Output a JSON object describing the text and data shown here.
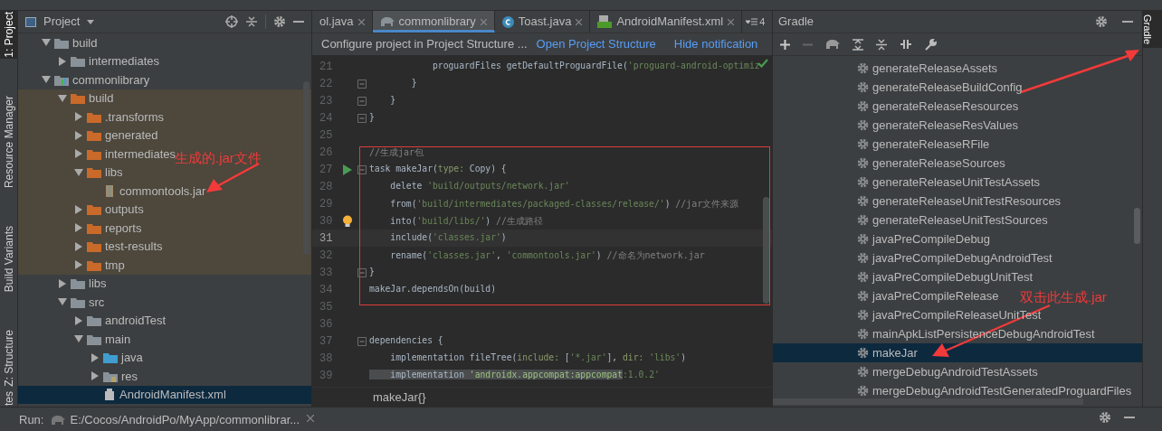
{
  "left_strip": [
    {
      "label": "1: Project",
      "selected": true
    },
    {
      "label": "Resource Manager",
      "selected": false
    },
    {
      "label": "Build Variants",
      "selected": false
    },
    {
      "label": "Z: Structure",
      "selected": false
    },
    {
      "label": "tes",
      "selected": false
    }
  ],
  "project_panel": {
    "title": "Project",
    "tree": [
      {
        "label": "build",
        "kind": "folder",
        "expanded": true,
        "excluded": false,
        "selected": false,
        "children": [
          {
            "label": "intermediates",
            "kind": "folder",
            "expanded": false,
            "excluded": false,
            "selected": false
          }
        ]
      },
      {
        "label": "commonlibrary",
        "kind": "module",
        "expanded": true,
        "excluded": false,
        "selected": false,
        "children": [
          {
            "label": "build",
            "kind": "folder",
            "expanded": true,
            "excluded": true,
            "selected": false,
            "children": [
              {
                "label": ".transforms",
                "kind": "folder",
                "expanded": false,
                "excluded": true,
                "selected": false
              },
              {
                "label": "generated",
                "kind": "folder",
                "expanded": false,
                "excluded": true,
                "selected": false
              },
              {
                "label": "intermediates",
                "kind": "folder",
                "expanded": false,
                "excluded": true,
                "selected": false
              },
              {
                "label": "libs",
                "kind": "folder",
                "expanded": true,
                "excluded": true,
                "selected": false,
                "children": [
                  {
                    "label": "commontools.jar",
                    "kind": "jar",
                    "excluded": true,
                    "selected": false
                  }
                ]
              },
              {
                "label": "outputs",
                "kind": "folder",
                "expanded": false,
                "excluded": true,
                "selected": false
              },
              {
                "label": "reports",
                "kind": "folder",
                "expanded": false,
                "excluded": true,
                "selected": false
              },
              {
                "label": "test-results",
                "kind": "folder",
                "expanded": false,
                "excluded": true,
                "selected": false
              },
              {
                "label": "tmp",
                "kind": "folder",
                "expanded": false,
                "excluded": true,
                "selected": false
              }
            ]
          },
          {
            "label": "libs",
            "kind": "folder",
            "expanded": false,
            "excluded": false,
            "selected": false
          },
          {
            "label": "src",
            "kind": "folder",
            "expanded": true,
            "excluded": false,
            "selected": false,
            "children": [
              {
                "label": "androidTest",
                "kind": "folder",
                "expanded": false,
                "excluded": false,
                "selected": false
              },
              {
                "label": "main",
                "kind": "folder",
                "expanded": true,
                "excluded": false,
                "selected": false,
                "children": [
                  {
                    "label": "java",
                    "kind": "java-folder",
                    "expanded": false,
                    "excluded": false,
                    "selected": false
                  },
                  {
                    "label": "res",
                    "kind": "res-folder",
                    "expanded": false,
                    "excluded": false,
                    "selected": false
                  },
                  {
                    "label": "AndroidManifest.xml",
                    "kind": "manifest",
                    "excluded": false,
                    "selected": true
                  }
                ]
              }
            ]
          }
        ]
      }
    ]
  },
  "editor": {
    "tabs": [
      {
        "label": "ol.java",
        "kind": "partial",
        "selected": false
      },
      {
        "label": "commonlibrary",
        "kind": "gradle",
        "selected": true
      },
      {
        "label": "Toast.java",
        "kind": "class",
        "selected": false
      },
      {
        "label": "AndroidManifest.xml",
        "kind": "manifest",
        "selected": false
      }
    ],
    "tab_overflow_count": "4",
    "notification": {
      "text": "Configure project in Project Structure ...",
      "links": [
        "Open Project Structure",
        "Hide notification"
      ]
    },
    "lines": [
      {
        "number": "21",
        "fold": false,
        "current": false,
        "segments": [
          {
            "kind": "plain",
            "text": "            proguardFiles getDefaultProguardFile("
          },
          {
            "kind": "str",
            "text": "'proguard-android-optimiz"
          }
        ]
      },
      {
        "number": "22",
        "fold": true,
        "current": false,
        "segments": [
          {
            "kind": "plain",
            "text": "        }"
          }
        ]
      },
      {
        "number": "23",
        "fold": true,
        "current": false,
        "segments": [
          {
            "kind": "plain",
            "text": "    }"
          }
        ]
      },
      {
        "number": "24",
        "fold": true,
        "current": false,
        "segments": [
          {
            "kind": "plain",
            "text": "}"
          }
        ]
      },
      {
        "number": "25",
        "fold": false,
        "current": false
      },
      {
        "number": "26",
        "fold": false,
        "current": false,
        "segments": [
          {
            "kind": "cmt",
            "text": "//生成jar包"
          }
        ]
      },
      {
        "number": "27",
        "fold": true,
        "current": false,
        "kind": "run",
        "segments": [
          {
            "kind": "plain",
            "text": "task makeJar("
          },
          {
            "kind": "param",
            "text": "type:"
          },
          {
            "kind": "plain",
            "text": " Copy) {"
          }
        ]
      },
      {
        "number": "28",
        "fold": false,
        "current": false,
        "segments": [
          {
            "kind": "plain",
            "text": "    delete "
          },
          {
            "kind": "str",
            "text": "'build/outputs/network.jar'"
          }
        ]
      },
      {
        "number": "29",
        "fold": false,
        "current": false,
        "segments": [
          {
            "kind": "plain",
            "text": "    from("
          },
          {
            "kind": "str",
            "text": "'build/intermediates/packaged-classes/release/'"
          },
          {
            "kind": "plain",
            "text": ") "
          },
          {
            "kind": "cmt",
            "text": "//jar文件来源"
          }
        ]
      },
      {
        "number": "30",
        "fold": false,
        "current": false,
        "kind": "bulb",
        "segments": [
          {
            "kind": "plain",
            "text": "    into("
          },
          {
            "kind": "str",
            "text": "'build/libs/'"
          },
          {
            "kind": "plain",
            "text": ") "
          },
          {
            "kind": "cmt",
            "text": "//生成路径"
          }
        ]
      },
      {
        "number": "31",
        "fold": false,
        "current": true,
        "segments": [
          {
            "kind": "plain",
            "text": "    include("
          },
          {
            "kind": "str",
            "text": "'classes.jar'"
          },
          {
            "kind": "plain",
            "text": ")"
          }
        ]
      },
      {
        "number": "32",
        "fold": false,
        "current": false,
        "segments": [
          {
            "kind": "plain",
            "text": "    rename("
          },
          {
            "kind": "str",
            "text": "'classes.jar'"
          },
          {
            "kind": "plain",
            "text": ", "
          },
          {
            "kind": "str",
            "text": "'commontools.jar'"
          },
          {
            "kind": "plain",
            "text": ") "
          },
          {
            "kind": "cmt",
            "text": "//命名为network.jar"
          }
        ]
      },
      {
        "number": "33",
        "fold": true,
        "current": false,
        "segments": [
          {
            "kind": "plain",
            "text": "}"
          }
        ]
      },
      {
        "number": "34",
        "fold": false,
        "current": false,
        "segments": [
          {
            "kind": "plain",
            "text": "makeJar.dependsOn(build)"
          }
        ]
      },
      {
        "number": "35",
        "fold": false,
        "current": false
      },
      {
        "number": "36",
        "fold": false,
        "current": false
      },
      {
        "number": "37",
        "fold": true,
        "current": false,
        "segments": [
          {
            "kind": "plain",
            "text": "dependencies {"
          }
        ]
      },
      {
        "number": "38",
        "fold": false,
        "current": false,
        "segments": [
          {
            "kind": "plain",
            "text": "    implementation fileTree("
          },
          {
            "kind": "param",
            "text": "include:"
          },
          {
            "kind": "plain",
            "text": " ["
          },
          {
            "kind": "str",
            "text": "'*.jar'"
          },
          {
            "kind": "plain",
            "text": "], "
          },
          {
            "kind": "param",
            "text": "dir: "
          },
          {
            "kind": "str",
            "text": "'libs'"
          },
          {
            "kind": "plain",
            "text": ")"
          }
        ]
      },
      {
        "number": "39",
        "fold": false,
        "current": false,
        "segments": [
          {
            "kind": "warn",
            "text": "    implementation "
          },
          {
            "kind": "warn-str",
            "text": "'androidx.appcompat:appcompat"
          },
          {
            "kind": "str",
            "text": ":1.0.2'"
          }
        ]
      }
    ],
    "breadcrumb": "makeJar{}"
  },
  "gradle_panel": {
    "title": "Gradle",
    "tasks": [
      {
        "label": "generateReleaseAssets",
        "selected": false
      },
      {
        "label": "generateReleaseBuildConfig",
        "selected": false
      },
      {
        "label": "generateReleaseResources",
        "selected": false
      },
      {
        "label": "generateReleaseResValues",
        "selected": false
      },
      {
        "label": "generateReleaseRFile",
        "selected": false
      },
      {
        "label": "generateReleaseSources",
        "selected": false
      },
      {
        "label": "generateReleaseUnitTestAssets",
        "selected": false
      },
      {
        "label": "generateReleaseUnitTestResources",
        "selected": false
      },
      {
        "label": "generateReleaseUnitTestSources",
        "selected": false
      },
      {
        "label": "javaPreCompileDebug",
        "selected": false
      },
      {
        "label": "javaPreCompileDebugAndroidTest",
        "selected": false
      },
      {
        "label": "javaPreCompileDebugUnitTest",
        "selected": false
      },
      {
        "label": "javaPreCompileRelease",
        "selected": false
      },
      {
        "label": "javaPreCompileReleaseUnitTest",
        "selected": false
      },
      {
        "label": "mainApkListPersistenceDebugAndroidTest",
        "selected": false
      },
      {
        "label": "makeJar",
        "selected": true
      },
      {
        "label": "mergeDebugAndroidTestAssets",
        "selected": false
      },
      {
        "label": "mergeDebugAndroidTestGeneratedProguardFiles",
        "selected": false
      }
    ]
  },
  "right_strip": [
    {
      "label": "Gradle",
      "selected": true
    }
  ],
  "run_bar": {
    "label": "Run:",
    "tab": "E:/Cocos/AndroidPo/MyApp/commonlibrar..."
  },
  "annotations": [
    "生成的.jar文件",
    "双击此生成.jar"
  ]
}
